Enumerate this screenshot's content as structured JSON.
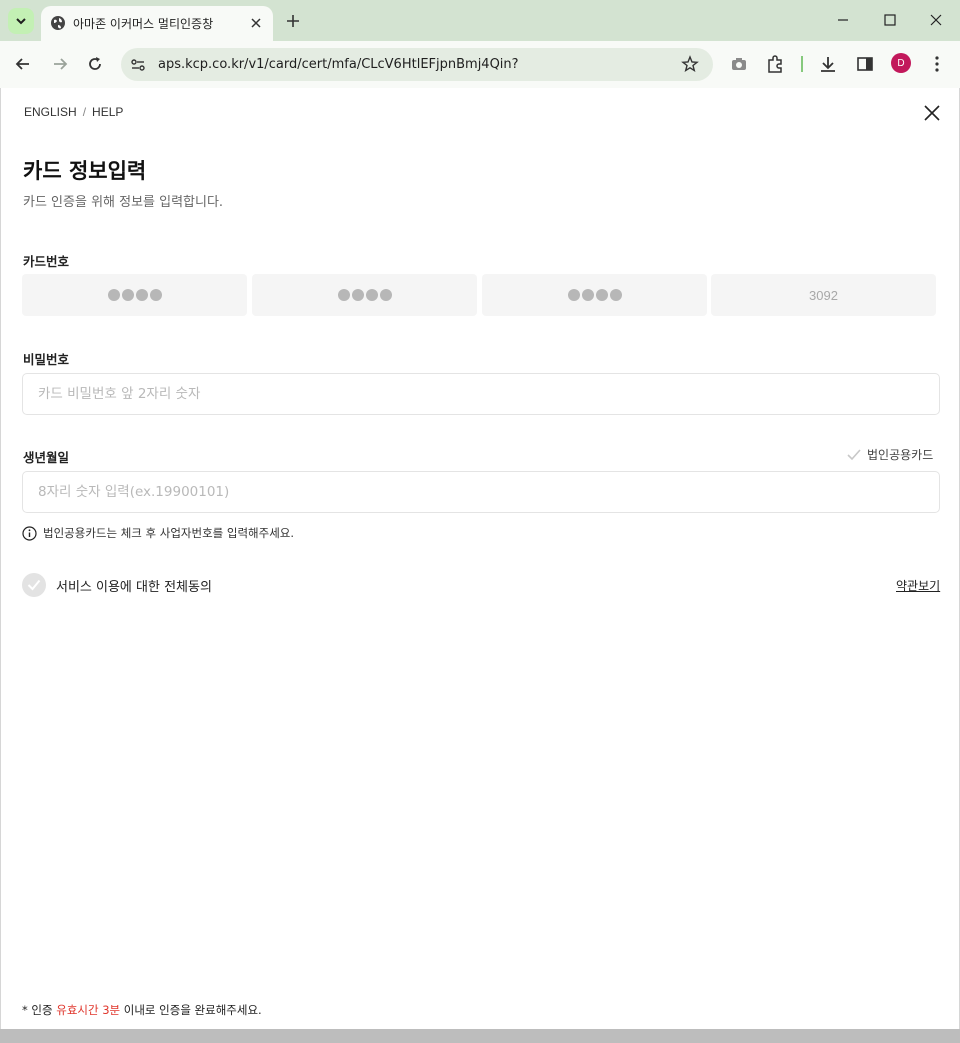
{
  "browser": {
    "tab_title": "아마존 이커머스 멀티인증창",
    "url": "aps.kcp.co.kr/v1/card/cert/mfa/CLcV6HtlEFjpnBmj4Qin?",
    "profile_initial": "D",
    "accent": "#d3e3d1"
  },
  "page": {
    "lang_english": "ENGLISH",
    "lang_sep": "/",
    "lang_help": "HELP",
    "title": "카드 정보입력",
    "subtitle": "카드 인증을 위해 정보를 입력합니다.",
    "card_number": {
      "label": "카드번호",
      "last_group": "3092"
    },
    "password": {
      "label": "비밀번호",
      "placeholder": "카드 비밀번호 앞 2자리 숫자"
    },
    "birth": {
      "label": "생년월일",
      "placeholder": "8자리 숫자 입력(ex.19900101)",
      "corp_card_label": "법인공용카드"
    },
    "info_note": "법인공용카드는 체크 후 사업자번호를 입력해주세요.",
    "agree_label": "서비스 이용에 대한 전체동의",
    "terms_link": "약관보기",
    "footer": {
      "prefix": "* 인증 ",
      "highlight": "유효시간 3분",
      "suffix": " 이내로 인증을 완료해주세요.",
      "highlight_color": "#e0362c"
    }
  }
}
